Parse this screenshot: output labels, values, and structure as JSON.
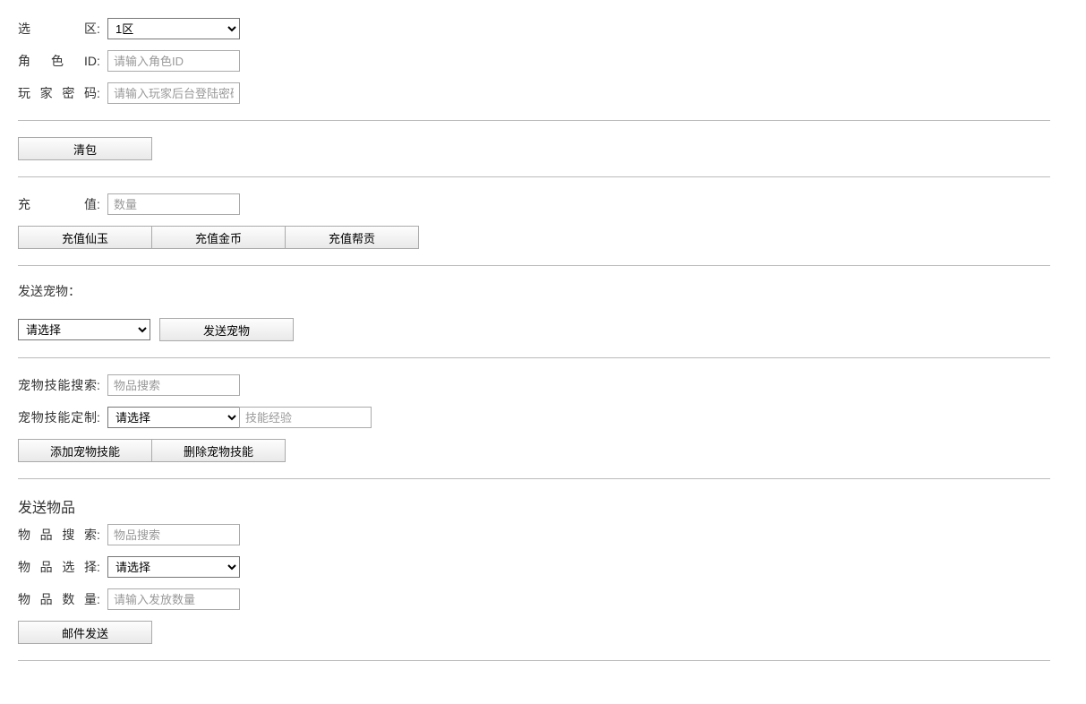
{
  "header": {
    "zone_label": "选区",
    "zone_value": "1区",
    "role_label": "角色ID",
    "role_placeholder": "请输入角色ID",
    "password_label": "玩家密码",
    "password_placeholder": "请输入玩家后台登陆密码"
  },
  "buttons": {
    "clear_bag": "清包",
    "recharge_xianyu": "充值仙玉",
    "recharge_gold": "充值金币",
    "recharge_banggong": "充值帮贡",
    "send_pet": "发送宠物",
    "add_pet_skill": "添加宠物技能",
    "remove_pet_skill": "删除宠物技能",
    "mail_send": "邮件发送"
  },
  "recharge": {
    "label": "充值",
    "placeholder": "数量"
  },
  "pet": {
    "send_label": "发送宠物：",
    "select_placeholder": "请选择",
    "skill_search_label": "宠物技能搜索",
    "skill_search_placeholder": "物品搜索",
    "skill_custom_label": "宠物技能定制",
    "skill_custom_select": "请选择",
    "skill_exp_placeholder": "技能经验"
  },
  "item": {
    "section_title": "发送物品",
    "search_label": "物品搜索",
    "search_placeholder": "物品搜索",
    "select_label": "物品选择",
    "select_placeholder": "请选择",
    "qty_label": "物品数量",
    "qty_placeholder": "请输入发放数量"
  }
}
